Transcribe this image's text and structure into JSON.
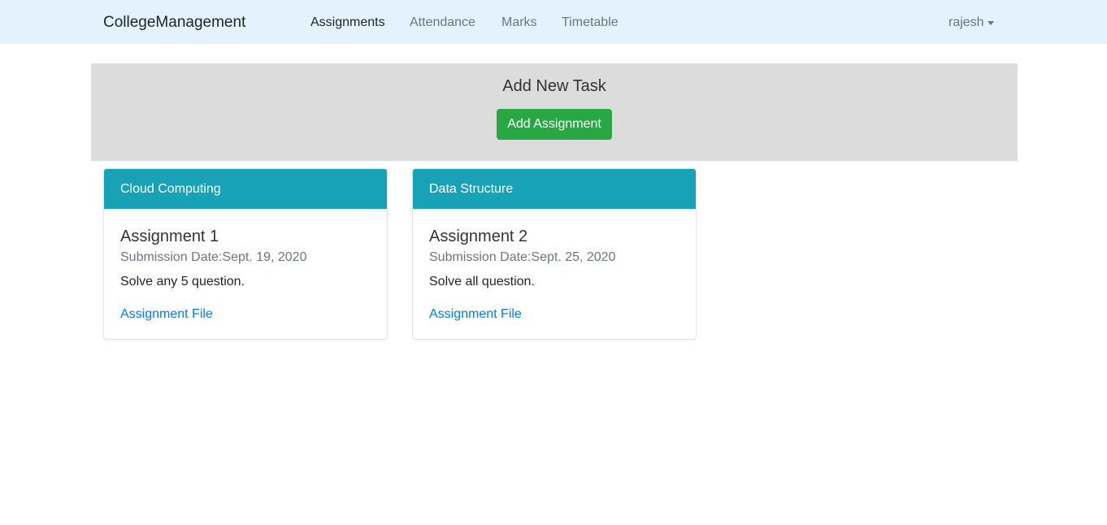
{
  "navbar": {
    "brand": "CollegeManagement",
    "links": [
      {
        "label": "Assignments",
        "active": true
      },
      {
        "label": "Attendance",
        "active": false
      },
      {
        "label": "Marks",
        "active": false
      },
      {
        "label": "Timetable",
        "active": false
      }
    ],
    "user": "rajesh"
  },
  "jumbotron": {
    "title": "Add New Task",
    "button_label": "Add Assignment"
  },
  "cards": [
    {
      "subject": "Cloud Computing",
      "title": "Assignment 1",
      "submission": "Submission Date:Sept. 19, 2020",
      "description": "Solve any 5 question.",
      "link_label": "Assignment File"
    },
    {
      "subject": "Data Structure",
      "title": "Assignment 2",
      "submission": "Submission Date:Sept. 25, 2020",
      "description": "Solve all question.",
      "link_label": "Assignment File"
    }
  ],
  "colors": {
    "navbar_bg": "#e3f2fd",
    "jumbotron_bg": "#dcdcdc",
    "button_green": "#28a745",
    "card_header_teal": "#17a2b8",
    "link_blue": "#007bff"
  }
}
